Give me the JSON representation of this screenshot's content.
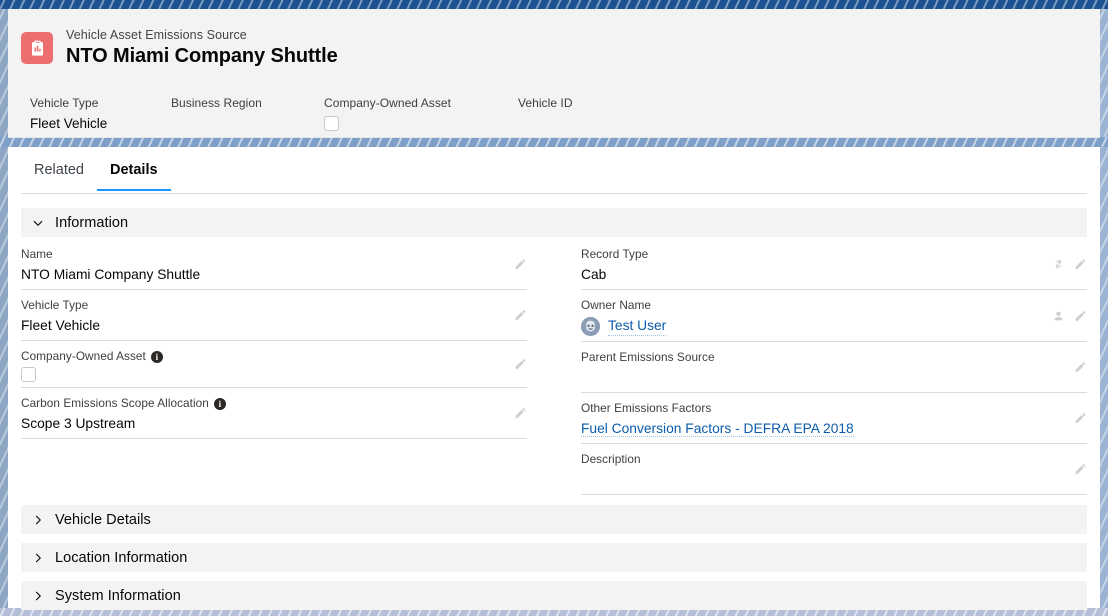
{
  "window": {
    "frame_color": "#1c5291",
    "accent_color": "#1b96ff",
    "link_color": "#0b5cab",
    "record_icon_color": "#ed6e6e"
  },
  "header": {
    "object_label": "Vehicle Asset Emissions Source",
    "record_title": "NTO Miami Company Shuttle",
    "record_icon": "clipboard-chart-icon",
    "compact_fields": [
      {
        "label": "Vehicle Type",
        "value": "Fleet Vehicle",
        "type": "text"
      },
      {
        "label": "Business Region",
        "value": "",
        "type": "text"
      },
      {
        "label": "Company-Owned Asset",
        "value": "",
        "type": "checkbox",
        "checked": false
      },
      {
        "label": "Vehicle ID",
        "value": "",
        "type": "text"
      }
    ]
  },
  "tabs": [
    {
      "label": "Related",
      "active": false
    },
    {
      "label": "Details",
      "active": true
    }
  ],
  "sections": {
    "information": {
      "title": "Information",
      "expanded": true,
      "chevron": "chevron-down-icon",
      "left_fields": [
        {
          "label": "Name",
          "value": "NTO Miami Company Shuttle",
          "type": "text",
          "has_info": false,
          "edit_icon": "pencil-icon"
        },
        {
          "label": "Vehicle Type",
          "value": "Fleet Vehicle",
          "type": "text",
          "has_info": false,
          "edit_icon": "pencil-icon"
        },
        {
          "label": "Company-Owned Asset",
          "value": "",
          "type": "checkbox",
          "checked": false,
          "has_info": true,
          "edit_icon": "pencil-icon"
        },
        {
          "label": "Carbon Emissions Scope Allocation",
          "value": "Scope 3 Upstream",
          "type": "text",
          "has_info": true,
          "edit_icon": "pencil-icon"
        }
      ],
      "right_fields": [
        {
          "label": "Record Type",
          "value": "Cab",
          "type": "text",
          "has_info": false,
          "edit_icon": "pencil-icon",
          "extra_icon": "change-record-type-icon"
        },
        {
          "label": "Owner Name",
          "value": "Test User",
          "type": "link-with-avatar",
          "avatar": "user-avatar-icon",
          "has_info": false,
          "edit_icon": "pencil-icon",
          "extra_icon": "change-owner-icon"
        },
        {
          "label": "Parent Emissions Source",
          "value": "",
          "type": "text",
          "has_info": false,
          "edit_icon": "pencil-icon"
        },
        {
          "label": "Other Emissions Factors",
          "value": "Fuel Conversion Factors - DEFRA EPA 2018",
          "type": "link",
          "has_info": false,
          "edit_icon": "pencil-icon"
        },
        {
          "label": "Description",
          "value": "",
          "type": "text",
          "has_info": false,
          "edit_icon": "pencil-icon"
        }
      ]
    },
    "collapsed": [
      {
        "title": "Vehicle Details",
        "expanded": false,
        "chevron": "chevron-right-icon"
      },
      {
        "title": "Location Information",
        "expanded": false,
        "chevron": "chevron-right-icon"
      },
      {
        "title": "System Information",
        "expanded": false,
        "chevron": "chevron-right-icon"
      }
    ]
  }
}
